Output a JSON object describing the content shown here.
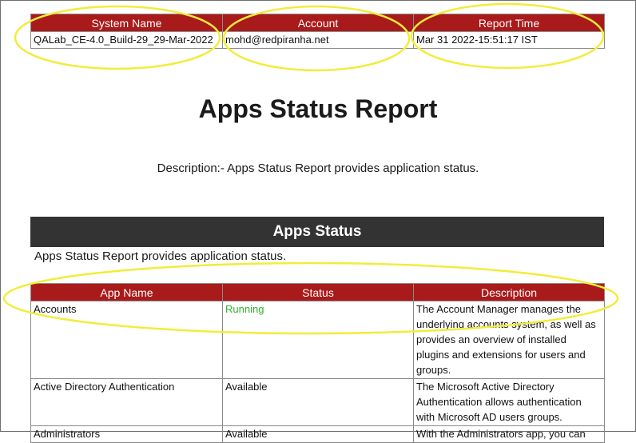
{
  "meta_table": {
    "headers": [
      "System Name",
      "Account",
      "Report Time"
    ],
    "values": [
      "QALab_CE-4.0_Build-29_29-Mar-2022",
      "mohd@redpiranha.net",
      "Mar 31 2022-15:51:17 IST"
    ]
  },
  "report": {
    "title": "Apps Status Report",
    "description": "Description:- Apps Status Report provides application status."
  },
  "section": {
    "title": "Apps Status",
    "subtitle": "Apps Status Report provides application status."
  },
  "apps_table": {
    "headers": [
      "App Name",
      "Status",
      "Description"
    ],
    "rows": [
      {
        "name": "Accounts",
        "status": "Running",
        "description": "The Account Manager manages the underlying accounts system, as well as provides an overview of installed plugins and extensions for users and groups."
      },
      {
        "name": "Active Directory Authentication",
        "status": "Available",
        "description": "The Microsoft Active Directory Authentication allows authentication with Microsoft AD users groups."
      },
      {
        "name": "Administrators",
        "status": "Available",
        "description": "With the Administrators app, you can"
      }
    ]
  },
  "colors": {
    "header_red": "#a91a1a",
    "section_bar": "#333333",
    "running_green": "#31b131",
    "highlight_yellow": "#f2ec3a"
  }
}
